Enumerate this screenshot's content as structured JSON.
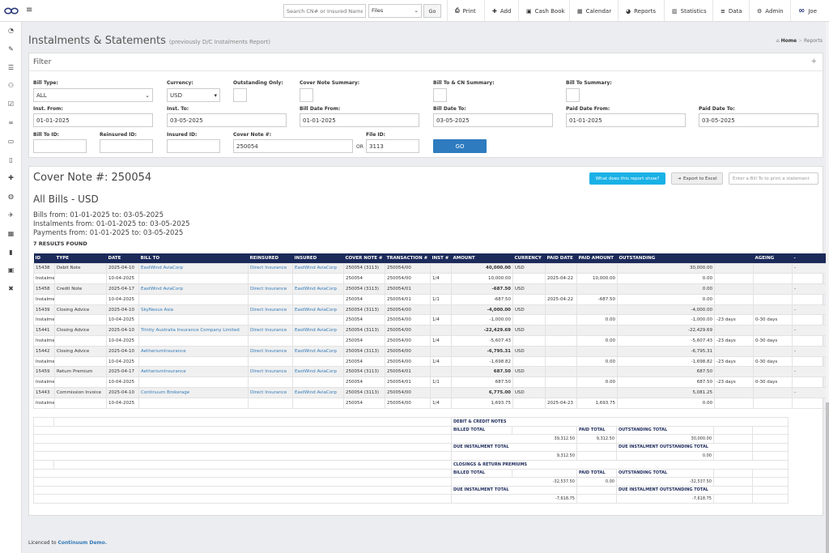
{
  "topbar": {
    "menu_icon": "hamburger-icon",
    "search_placeholder": "Search CN# or Insured Name",
    "search_scope": "Files",
    "search_go": "Go",
    "nav": [
      {
        "label": "Print",
        "icon": "print-icon",
        "glyph": "⎙"
      },
      {
        "label": "Add",
        "icon": "plus-icon",
        "glyph": "✚"
      },
      {
        "label": "Cash Book",
        "icon": "money-icon",
        "glyph": "▣"
      },
      {
        "label": "Calendar",
        "icon": "calendar-icon",
        "glyph": "▦"
      },
      {
        "label": "Reports",
        "icon": "pie-chart-icon",
        "glyph": "◕"
      },
      {
        "label": "Statistics",
        "icon": "bar-chart-icon",
        "glyph": "▥"
      },
      {
        "label": "Data",
        "icon": "database-icon",
        "glyph": "≡"
      },
      {
        "label": "Admin",
        "icon": "cogs-icon",
        "glyph": "⚙"
      },
      {
        "label": "Joe",
        "icon": "user-logo-icon",
        "glyph": "∞"
      }
    ]
  },
  "sidebar": [
    "dashboard-icon",
    "pencil-icon",
    "list-icon",
    "users-icon",
    "check-square-icon",
    "binoculars-icon",
    "car-icon",
    "file-icon",
    "plus-icon",
    "globe-icon",
    "plane-icon",
    "calculator-icon",
    "bookmark-icon",
    "briefcase-icon",
    "close-icon"
  ],
  "header": {
    "title": "Instalments & Statements",
    "subtitle": "(previously D/C Instalments Report)",
    "breadcrumb_home": "Home",
    "breadcrumb_sep": ">",
    "breadcrumb_current": "Reports"
  },
  "filter": {
    "title": "Filter",
    "toggle": "+",
    "bill_type_label": "Bill Type:",
    "bill_type_value": "ALL",
    "currency_label": "Currency:",
    "currency_value": "USD",
    "outstanding_label": "Outstanding Only:",
    "cover_note_summary_label": "Cover Note Summary:",
    "bill_to_cn_summary_label": "Bill To & CN Summary:",
    "bill_to_summary_label": "Bill To Summary:",
    "inst_from_label": "Inst. From:",
    "inst_from_value": "01-01-2025",
    "inst_to_label": "Inst. To:",
    "inst_to_value": "03-05-2025",
    "bill_date_from_label": "Bill Date From:",
    "bill_date_from_value": "01-01-2025",
    "bill_date_to_label": "Bill Date To:",
    "bill_date_to_value": "03-05-2025",
    "paid_date_from_label": "Paid Date From:",
    "paid_date_from_value": "01-01-2025",
    "paid_date_to_label": "Paid Date To:",
    "paid_date_to_value": "03-05-2025",
    "bill_to_id_label": "Bill To ID:",
    "reinsured_id_label": "Reinsured ID:",
    "insured_id_label": "Insured ID:",
    "cover_note_label": "Cover Note #:",
    "cover_note_value": "250054",
    "or_label": "OR",
    "file_id_label": "File ID:",
    "file_id_value": "3113",
    "go": "GO"
  },
  "report": {
    "cover_note_title": "Cover Note #: 250054",
    "what_button": "What does this report show?",
    "export_button": "Export to Excel",
    "bill_to_placeholder": "Enter a Bill To to print a statement",
    "all_bills_title": "All Bills - USD",
    "bills_range": "Bills from: 01-01-2025 to: 03-05-2025",
    "instalments_range": "Instalments from: 01-01-2025 to: 03-05-2025",
    "payments_range": "Payments from: 01-01-2025 to: 03-05-2025",
    "results_count": "7 RESULTS FOUND",
    "columns": [
      "ID",
      "TYPE",
      "DATE",
      "BILL TO",
      "REINSURED",
      "INSURED",
      "COVER NOTE #",
      "TRANSACTION #",
      "INST #",
      "AMOUNT",
      "CURRENCY",
      "PAID DATE",
      "PAID AMOUNT",
      "OUTSTANDING",
      "",
      "AGEING",
      "-",
      ""
    ],
    "view_label": "View",
    "rows": [
      {
        "kind": "bill",
        "id": "15438",
        "type": "Debit Note",
        "date": "2025-04-10",
        "bill_to": "EastWind AviaCorp",
        "reinsured": "Direct Insurance",
        "insured": "EastWind AviaCorp",
        "cover_note": "250054 (3113)",
        "transaction": "250054/00",
        "inst": "",
        "amount": "40,000.00",
        "currency": "USD",
        "paid_date": "",
        "paid_amount": "",
        "outstanding": "30,000.00",
        "days": "",
        "ageing": "",
        "dash": "-"
      },
      {
        "kind": "inst",
        "id": "Instalment:",
        "type": "",
        "date": "10-04-2025",
        "bill_to": "",
        "reinsured": "",
        "insured": "",
        "cover_note": "250054",
        "transaction": "250054/00",
        "inst": "1/4",
        "amount": "10,000.00",
        "currency": "",
        "paid_date": "2025-04-22",
        "paid_amount": "10,000.00",
        "outstanding": "0.00",
        "days": "",
        "ageing": "",
        "dash": ""
      },
      {
        "kind": "bill",
        "id": "15458",
        "type": "Credit Note",
        "date": "2025-04-17",
        "bill_to": "EastWind AviaCorp",
        "reinsured": "Direct Insurance",
        "insured": "EastWind AviaCorp",
        "cover_note": "250054 (3113)",
        "transaction": "250054/01",
        "inst": "",
        "amount": "-687.50",
        "currency": "USD",
        "paid_date": "",
        "paid_amount": "",
        "outstanding": "0.00",
        "days": "",
        "ageing": "",
        "dash": "-"
      },
      {
        "kind": "inst",
        "id": "Instalment:",
        "type": "",
        "date": "10-04-2025",
        "bill_to": "",
        "reinsured": "",
        "insured": "",
        "cover_note": "250054",
        "transaction": "250054/01",
        "inst": "1/1",
        "amount": "-687.50",
        "currency": "",
        "paid_date": "2025-04-22",
        "paid_amount": "-687.50",
        "outstanding": "0.00",
        "days": "",
        "ageing": "",
        "dash": ""
      },
      {
        "kind": "bill",
        "id": "15439",
        "type": "Closing Advice",
        "date": "2025-04-10",
        "bill_to": "SkyNexus Asia",
        "reinsured": "Direct Insurance",
        "insured": "EastWind AviaCorp",
        "cover_note": "250054 (3113)",
        "transaction": "250054/00",
        "inst": "",
        "amount": "-4,000.00",
        "currency": "USD",
        "paid_date": "",
        "paid_amount": "",
        "outstanding": "-4,000.00",
        "days": "",
        "ageing": "",
        "dash": "-"
      },
      {
        "kind": "inst",
        "id": "Instalment:",
        "type": "",
        "date": "10-04-2025",
        "bill_to": "",
        "reinsured": "",
        "insured": "",
        "cover_note": "250054",
        "transaction": "250054/00",
        "inst": "1/4",
        "amount": "-1,000.00",
        "currency": "",
        "paid_date": "",
        "paid_amount": "0.00",
        "outstanding": "-1,000.00",
        "days": "-23 days",
        "ageing": "0-30 days",
        "dash": ""
      },
      {
        "kind": "bill",
        "id": "15441",
        "type": "Closing Advice",
        "date": "2025-04-10",
        "bill_to": "Trinity Australia Insurance Company Limited",
        "reinsured": "Direct Insurance",
        "insured": "EastWind AviaCorp",
        "cover_note": "250054 (3113)",
        "transaction": "250054/00",
        "inst": "",
        "amount": "-22,429.69",
        "currency": "USD",
        "paid_date": "",
        "paid_amount": "",
        "outstanding": "-22,429.69",
        "days": "",
        "ageing": "",
        "dash": "-"
      },
      {
        "kind": "inst",
        "id": "Instalment:",
        "type": "",
        "date": "10-04-2025",
        "bill_to": "",
        "reinsured": "",
        "insured": "",
        "cover_note": "250054",
        "transaction": "250054/00",
        "inst": "1/4",
        "amount": "-5,607.43",
        "currency": "",
        "paid_date": "",
        "paid_amount": "0.00",
        "outstanding": "-5,607.43",
        "days": "-23 days",
        "ageing": "0-30 days",
        "dash": ""
      },
      {
        "kind": "bill",
        "id": "15442",
        "type": "Closing Advice",
        "date": "2025-04-10",
        "bill_to": "AetheriumInsurance",
        "reinsured": "Direct Insurance",
        "insured": "EastWind AviaCorp",
        "cover_note": "250054 (3113)",
        "transaction": "250054/00",
        "inst": "",
        "amount": "-6,795.31",
        "currency": "USD",
        "paid_date": "",
        "paid_amount": "",
        "outstanding": "-6,795.31",
        "days": "",
        "ageing": "",
        "dash": "-"
      },
      {
        "kind": "inst",
        "id": "Instalment:",
        "type": "",
        "date": "10-04-2025",
        "bill_to": "",
        "reinsured": "",
        "insured": "",
        "cover_note": "250054",
        "transaction": "250054/00",
        "inst": "1/4",
        "amount": "-1,698.82",
        "currency": "",
        "paid_date": "",
        "paid_amount": "0.00",
        "outstanding": "-1,698.82",
        "days": "-23 days",
        "ageing": "0-30 days",
        "dash": ""
      },
      {
        "kind": "bill",
        "id": "15459",
        "type": "Return Premium",
        "date": "2025-04-17",
        "bill_to": "AetheriumInsurance",
        "reinsured": "Direct Insurance",
        "insured": "EastWind AviaCorp",
        "cover_note": "250054 (3113)",
        "transaction": "250054/01",
        "inst": "",
        "amount": "687.50",
        "currency": "USD",
        "paid_date": "",
        "paid_amount": "",
        "outstanding": "687.50",
        "days": "",
        "ageing": "",
        "dash": "-"
      },
      {
        "kind": "inst",
        "id": "Instalment:",
        "type": "",
        "date": "10-04-2025",
        "bill_to": "",
        "reinsured": "",
        "insured": "",
        "cover_note": "250054",
        "transaction": "250054/01",
        "inst": "1/1",
        "amount": "687.50",
        "currency": "",
        "paid_date": "",
        "paid_amount": "0.00",
        "outstanding": "687.50",
        "days": "-23 days",
        "ageing": "0-30 days",
        "dash": ""
      },
      {
        "kind": "bill",
        "id": "15443",
        "type": "Commission Invoice",
        "date": "2025-04-10",
        "bill_to": "Continuum Brokerage",
        "reinsured": "Direct Insurance",
        "insured": "EastWind AviaCorp",
        "cover_note": "250054 (3113)",
        "transaction": "250054/00",
        "inst": "",
        "amount": "6,775.00",
        "currency": "USD",
        "paid_date": "",
        "paid_amount": "",
        "outstanding": "5,081.25",
        "days": "",
        "ageing": "",
        "dash": "-"
      },
      {
        "kind": "inst",
        "id": "Instalment:",
        "type": "",
        "date": "10-04-2025",
        "bill_to": "",
        "reinsured": "",
        "insured": "",
        "cover_note": "250054",
        "transaction": "250054/00",
        "inst": "1/4",
        "amount": "1,693.75",
        "currency": "",
        "paid_date": "2025-04-23",
        "paid_amount": "1,693.75",
        "outstanding": "0.00",
        "days": "",
        "ageing": "",
        "dash": ""
      }
    ],
    "debit_credit": {
      "title": "DEBIT & CREDIT NOTES",
      "billed_total_label": "BILLED TOTAL",
      "billed_total": "39,312.50",
      "paid_total_label": "PAID TOTAL",
      "paid_total": "9,312.50",
      "outstanding_total_label": "OUTSTANDING TOTAL",
      "outstanding_total": "30,000.00",
      "due_inst_label": "DUE INSTALMENT TOTAL",
      "due_inst": "9,312.50",
      "due_inst_out_label": "DUE INSTALMENT OUTSTANDING TOTAL",
      "due_inst_out": "0.00"
    },
    "closings": {
      "title": "CLOSINGS & RETURN PREMIUMS",
      "billed_total_label": "BILLED TOTAL",
      "billed_total": "-32,537.50",
      "paid_total_label": "PAID TOTAL",
      "paid_total": "0.00",
      "outstanding_total_label": "OUTSTANDING TOTAL",
      "outstanding_total": "-32,537.50",
      "due_inst_label": "DUE INSTALMENT TOTAL",
      "due_inst": "-7,618.75",
      "due_inst_out_label": "DUE INSTALMENT OUTSTANDING TOTAL",
      "due_inst_out": "-7,618.75"
    }
  },
  "footer": {
    "prefix": "Licenced to",
    "company": "Continuum Demo."
  },
  "colors": {
    "accent": "#2e7bbf",
    "table_header": "#1c2a5a",
    "info_button": "#1ab1e6"
  }
}
